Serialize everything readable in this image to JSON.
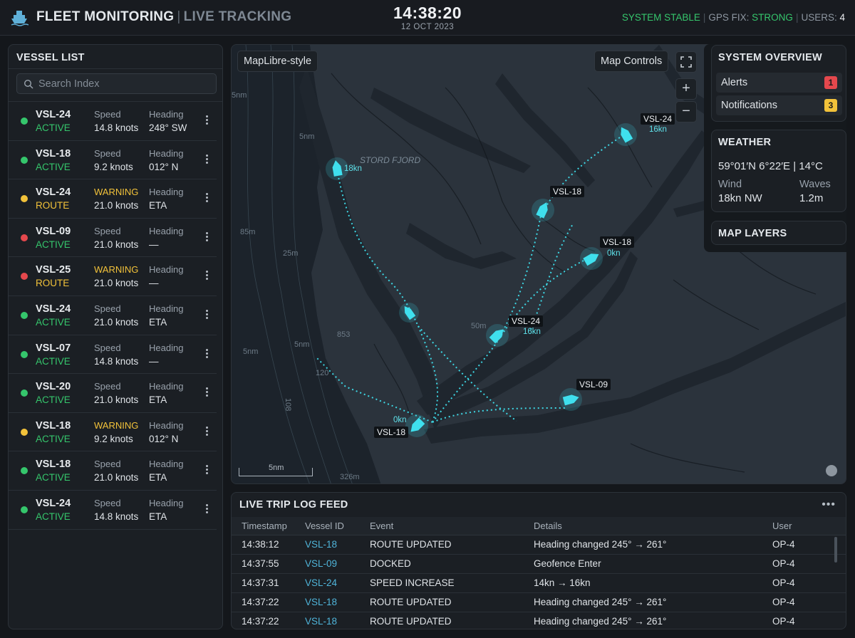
{
  "header": {
    "title": "FLEET MONITORING",
    "separator": "|",
    "subtitle": "LIVE TRACKING",
    "time": "14:38:20",
    "date": "12 OCT 2023",
    "status_system": "SYSTEM STABLE",
    "gps_label": "GPS FIX:",
    "gps_value": "STRONG",
    "users_label": "USERS:",
    "users_value": "4",
    "pipe": "|",
    "logo_icon": "ship-icon"
  },
  "vessel_list": {
    "title": "VESSEL LIST",
    "search_placeholder": "Search Index",
    "status_colors": {
      "active": "#35c66c",
      "warning": "#f2c23a",
      "alert": "#e5484d"
    },
    "items": [
      {
        "id": "VSL-24",
        "dot": "active",
        "state": "ACTIVE",
        "state_color": "#35c66c",
        "label1": "Speed",
        "value1": "14.8 knots",
        "label2": "Heading",
        "value2": "248° SW"
      },
      {
        "id": "VSL-18",
        "dot": "active",
        "state": "ACTIVE",
        "state_color": "#35c66c",
        "label1": "Speed",
        "value1": "9.2 knots",
        "label2": "Heading",
        "value2": "012° N"
      },
      {
        "id": "VSL-24",
        "dot": "warning",
        "state": "ROUTE",
        "state_color": "#f2c23a",
        "label1": "WARNING",
        "label1_color": "#f2c23a",
        "value1": "21.0 knots",
        "label2": "Heading",
        "value2": "ETA"
      },
      {
        "id": "VSL-09",
        "dot": "alert",
        "state": "ACTIVE",
        "state_color": "#35c66c",
        "label1": "Speed",
        "value1": "21.0 knots",
        "label2": "Heading",
        "value2": "—"
      },
      {
        "id": "VSL-25",
        "dot": "alert",
        "state": "ROUTE",
        "state_color": "#f2c23a",
        "label1": "WARNING",
        "label1_color": "#f2c23a",
        "value1": "21.0 knots",
        "label2": "Heading",
        "value2": "—"
      },
      {
        "id": "VSL-24",
        "dot": "active",
        "state": "ACTIVE",
        "state_color": "#35c66c",
        "label1": "Speed",
        "value1": "21.0 knots",
        "label2": "Heading",
        "value2": "ETA"
      },
      {
        "id": "VSL-07",
        "dot": "active",
        "state": "ACTIVE",
        "state_color": "#35c66c",
        "label1": "Speed",
        "value1": "14.8 knots",
        "label2": "Heading",
        "value2": "—"
      },
      {
        "id": "VSL-20",
        "dot": "active",
        "state": "ACTIVE",
        "state_color": "#35c66c",
        "label1": "Speed",
        "value1": "21.0 knots",
        "label2": "Heading",
        "value2": "ETA"
      },
      {
        "id": "VSL-18",
        "dot": "warning",
        "state": "ACTIVE",
        "state_color": "#35c66c",
        "label1": "WARNING",
        "label1_color": "#f2c23a",
        "value1": "9.2 knots",
        "label2": "Heading",
        "value2": "012° N"
      },
      {
        "id": "VSL-18",
        "dot": "active",
        "state": "ACTIVE",
        "state_color": "#35c66c",
        "label1": "Speed",
        "value1": "21.0 knots",
        "label2": "Heading",
        "value2": "ETA"
      },
      {
        "id": "VSL-24",
        "dot": "active",
        "state": "ACTIVE",
        "state_color": "#35c66c",
        "label1": "Speed",
        "value1": "14.8 knots",
        "label2": "Heading",
        "value2": "ETA"
      }
    ]
  },
  "map": {
    "style_label": "MapLibre-style",
    "controls_label": "Map Controls",
    "zoom_in": "+",
    "zoom_out": "−",
    "fullscreen_icon": "fullscreen-icon",
    "compass_icon": "compass-icon",
    "scale_label": "5nm",
    "accent_color": "#3fe0ee",
    "place_labels": [
      "STORD FJORD",
      "5nm",
      "5nm",
      "85m",
      "25m",
      "5nm",
      "120",
      "853",
      "5nm",
      "108",
      "326m",
      "50m"
    ],
    "vessels": [
      {
        "label": "VSL-24",
        "speed": "16kn"
      },
      {
        "label": "VSL-18",
        "speed": ""
      },
      {
        "label": "VSL-18",
        "speed": "0kn"
      },
      {
        "label": "VSL-24",
        "speed": "16kn"
      },
      {
        "label": "VSL-09",
        "speed": ""
      },
      {
        "label": "VSL-18",
        "speed": "0kn"
      },
      {
        "label": "",
        "speed": "18kn"
      }
    ]
  },
  "system_overview": {
    "title": "SYSTEM OVERVIEW",
    "alerts_label": "Alerts",
    "alerts_count": "1",
    "alerts_color": "#e5484d",
    "notifications_label": "Notifications",
    "notifications_count": "3",
    "notifications_color": "#f2c23a"
  },
  "weather": {
    "title": "WEATHER",
    "coords": "59°01′N 6°22′E | 14°C",
    "wind_label": "Wind",
    "wind_value": "18kn NW",
    "waves_label": "Waves",
    "waves_value": "1.2m"
  },
  "map_layers": {
    "title": "MAP LAYERS"
  },
  "log_feed": {
    "title": "LIVE TRIP LOG FEED",
    "more": "•••",
    "columns": [
      "Timestamp",
      "Vessel ID",
      "Event",
      "Details",
      "User"
    ],
    "rows": [
      [
        "14:38:12",
        "VSL-18",
        "ROUTE UPDATED",
        "Heading changed 245° → 261°",
        "OP-4"
      ],
      [
        "14:37:55",
        "VSL-09",
        "DOCKED",
        "Geofence Enter",
        "OP-4"
      ],
      [
        "14:37:31",
        "VSL-24",
        "SPEED INCREASE",
        "14kn → 16kn",
        "OP-4"
      ],
      [
        "14:37:22",
        "VSL-18",
        "ROUTE UPDATED",
        "Heading changed 245° → 261°",
        "OP-4"
      ],
      [
        "14:37:22",
        "VSL-18",
        "ROUTE UPDATED",
        "Heading changed 245° → 261°",
        "OP-4"
      ]
    ]
  }
}
